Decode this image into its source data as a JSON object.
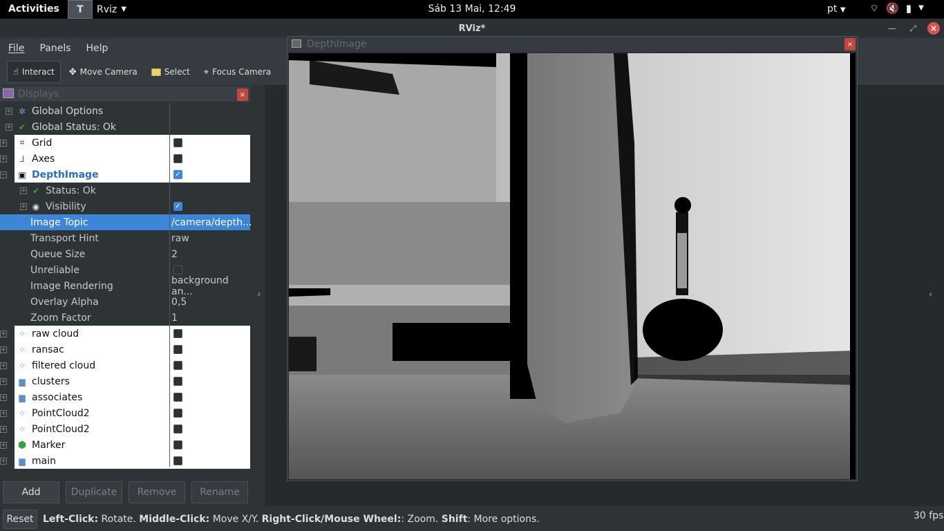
{
  "topbar": {
    "activities": "Activities",
    "app_name": "Rviz",
    "app_icon_letter": "T",
    "clock": "Sáb 13 Mai, 12:49",
    "lang": "pt"
  },
  "window": {
    "title": "RViz*"
  },
  "menu": {
    "file": "File",
    "panels": "Panels",
    "help": "Help"
  },
  "toolbar": {
    "interact": "Interact",
    "move_camera": "Move Camera",
    "select": "Select",
    "focus_camera": "Focus Camera"
  },
  "displays": {
    "title": "Displays",
    "rows": [
      {
        "label": "Global Options",
        "value": ""
      },
      {
        "label": "Global Status: Ok",
        "value": ""
      },
      {
        "label": "Grid",
        "checked": false
      },
      {
        "label": "Axes",
        "checked": false
      },
      {
        "label": "DepthImage",
        "checked": true
      },
      {
        "label": "Status: Ok"
      },
      {
        "label": "Visibility",
        "checked": true
      },
      {
        "label": "Image Topic",
        "value": "/camera/depth..."
      },
      {
        "label": "Transport Hint",
        "value": "raw"
      },
      {
        "label": "Queue Size",
        "value": "2"
      },
      {
        "label": "Unreliable",
        "checked": false
      },
      {
        "label": "Image Rendering",
        "value": "background an..."
      },
      {
        "label": "Overlay Alpha",
        "value": "0,5"
      },
      {
        "label": "Zoom Factor",
        "value": "1"
      },
      {
        "label": "raw cloud",
        "checked": false
      },
      {
        "label": "ransac",
        "checked": false
      },
      {
        "label": "filtered cloud",
        "checked": false
      },
      {
        "label": "clusters",
        "checked": false
      },
      {
        "label": "associates",
        "checked": false
      },
      {
        "label": "PointCloud2",
        "checked": false
      },
      {
        "label": "PointCloud2",
        "checked": false
      },
      {
        "label": "Marker",
        "checked": false
      },
      {
        "label": "main",
        "checked": false
      }
    ],
    "buttons": {
      "add": "Add",
      "duplicate": "Duplicate",
      "remove": "Remove",
      "rename": "Rename"
    }
  },
  "depth_window": {
    "title": "DepthImage"
  },
  "status": {
    "reset": "Reset",
    "hint_parts": [
      "Left-Click:",
      " Rotate. ",
      "Middle-Click:",
      " Move X/Y. ",
      "Right-Click/Mouse Wheel:",
      ": Zoom. ",
      "Shift",
      ": More options."
    ],
    "fps": "30 fps"
  }
}
